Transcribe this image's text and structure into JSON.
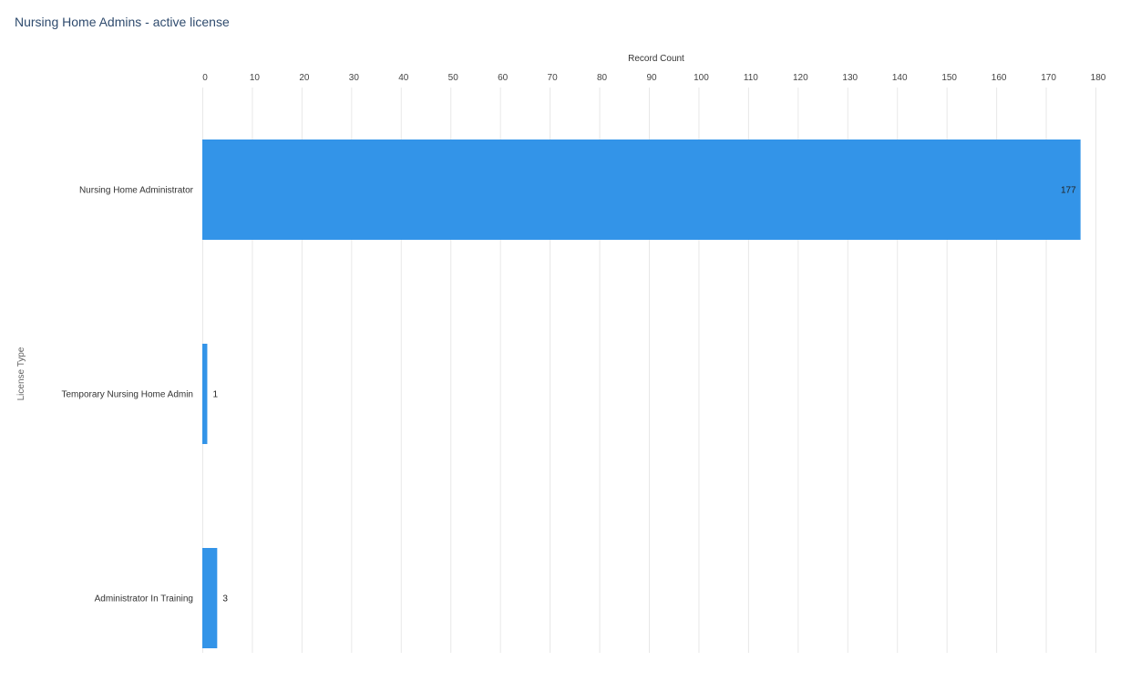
{
  "title": "Nursing Home Admins - active license",
  "colors": {
    "bar": "#3394e8",
    "title": "#2f4b6e",
    "grid": "#e8e8e8"
  },
  "chart_data": {
    "type": "bar",
    "orientation": "horizontal",
    "title": "Nursing Home Admins - active license",
    "xlabel": "Record Count",
    "ylabel": "License Type",
    "categories": [
      "Nursing Home Administrator",
      "Temporary Nursing Home Admin",
      "Administrator In Training"
    ],
    "values": [
      177,
      1,
      3
    ],
    "data_labels": [
      "177",
      "1",
      "3"
    ],
    "xlim": [
      0,
      180
    ],
    "x_ticks": [
      "0",
      "10",
      "20",
      "30",
      "40",
      "50",
      "60",
      "70",
      "80",
      "90",
      "100",
      "110",
      "120",
      "130",
      "140",
      "150",
      "160",
      "170",
      "180"
    ],
    "x_axis_position": "top",
    "grid": true,
    "legend": "none"
  }
}
